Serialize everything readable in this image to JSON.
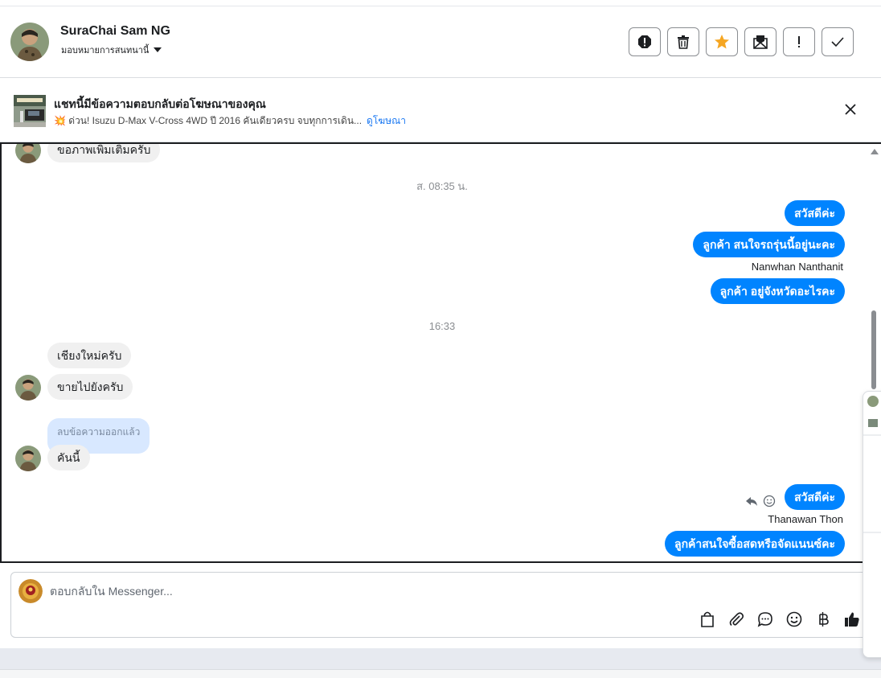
{
  "header": {
    "name": "SuraChai Sam NG",
    "assign_label": "มอบหมายการสนทนานี้",
    "tools": [
      {
        "name": "report-icon"
      },
      {
        "name": "trash-icon"
      },
      {
        "name": "star-icon",
        "color": "#f5a623"
      },
      {
        "name": "mark-unread-icon"
      },
      {
        "name": "spam-icon"
      },
      {
        "name": "done-check-icon"
      }
    ]
  },
  "ad_notice": {
    "title": "แชทนี้มีข้อความตอบกลับต่อโฆษณาของคุณ",
    "ad_text": "💥 ด่วน! Isuzu D-Max V-Cross 4WD ปี 2016 คันเดียวครบ จบทุกการเดิน...",
    "link_label": "ดูโฆษณา"
  },
  "messages": {
    "m0": "ขอภาพเพิ่มเติมครับ",
    "ts1": "ส. 08:35 น.",
    "m1": "สวัสดีค่ะ",
    "m2": "ลูกค้า สนใจรถรุ่นนี้อยู่นะคะ",
    "sender1": "Nanwhan Nanthanit",
    "m3": "ลูกค้า อยู่จังหวัดอะไรคะ",
    "ts2": "16:33",
    "m4": "เชียงใหม่ครับ",
    "m5": "ขายไปยังครับ",
    "deleted": "ลบข้อความออกแล้ว",
    "m6": "คันนี้",
    "m7": "สวัสดีค่ะ",
    "sender2": "Thanawan Thon",
    "m8": "ลูกค้าสนใจซื้อสดหรือจัดแนนซ์คะ"
  },
  "composer": {
    "placeholder": "ตอบกลับใน Messenger...",
    "tools": [
      "shopping-bag-icon",
      "paperclip-icon",
      "saved-reply-icon",
      "emoji-icon",
      "baht-icon",
      "thumbs-up-icon"
    ]
  },
  "colors": {
    "outgoing_bubble": "#0084ff",
    "incoming_bubble": "#f0f0f0",
    "deleted_bubble": "#d8e8ff",
    "link": "#1877f2"
  }
}
